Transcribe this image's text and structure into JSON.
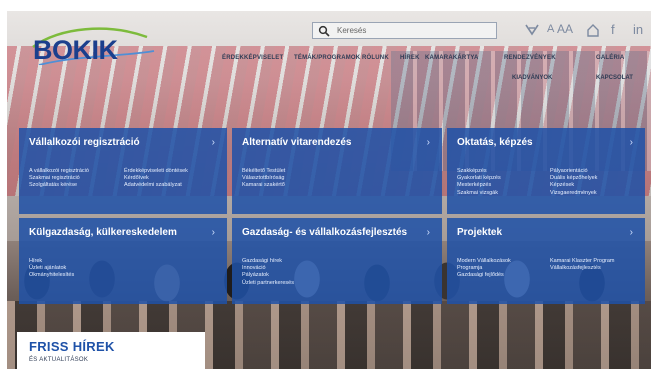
{
  "header": {
    "logo_text": "BOKIK",
    "logo_subtitle": "",
    "search_placeholder": "Keresés",
    "tools": [
      "A",
      "AA",
      "f",
      "in"
    ],
    "colors": {
      "brand_blue": "#1b3f8d",
      "tile_blue": "#1f52a8",
      "swoosh_green": "#7dbb3c"
    }
  },
  "nav": {
    "row1": [
      "ÉRDEKKÉPVISELET",
      "TÉMÁK/PROGRAMOK",
      "RÓLUNK",
      "HÍREK",
      "KAMARAKÁRTYA",
      "RENDEZVÉNYEK",
      "GALÉRIA"
    ],
    "row2": [
      "KIADVÁNYOK",
      "KAPCSOLAT"
    ]
  },
  "tiles": [
    {
      "title": "Vállalkozói regisztráció",
      "col1": [
        "A vállalkozói regisztráció",
        "Szakmai regisztráció",
        "Szolgáltatás kérése"
      ],
      "col2": [
        "Érdekképviseleti döntések",
        "Kérdőívek",
        "Adatvédelmi szabályzat"
      ]
    },
    {
      "title": "Alternatív vitarendezés",
      "col1": [
        "Békéltető Testület",
        "Választottbíróság",
        "Kamarai szakértő"
      ],
      "col2": []
    },
    {
      "title": "Oktatás, képzés",
      "col1": [
        "Szakképzés",
        "Gyakorlati képzés",
        "Mesterképzés",
        "Szakmai vizsgák"
      ],
      "col2": [
        "Pályaorientáció",
        "Duális képzőhelyek",
        "Képzések",
        "Vizsgaeredmények"
      ]
    },
    {
      "title": "Külgazdaság, külkereskedelem",
      "col1": [
        "Hírek",
        "Üzleti ajánlatok",
        "Okmányhitelesítés"
      ],
      "col2": []
    },
    {
      "title": "Gazdaság- és vállalkozásfejlesztés",
      "col1": [
        "Gazdasági hírek",
        "Innováció",
        "Pályázatok",
        "Üzleti partnerkeresés"
      ],
      "col2": []
    },
    {
      "title": "Projektek",
      "col1": [
        "Modern Vállalkozások",
        "Programja",
        "Gazdasági fejlődés"
      ],
      "col2": [
        "Kamarai Klaszter Program",
        "Vállalkozásfejlesztés"
      ]
    }
  ],
  "news": {
    "heading": "FRISS HÍREK",
    "subheading": "ÉS AKTUALITÁSOK"
  }
}
